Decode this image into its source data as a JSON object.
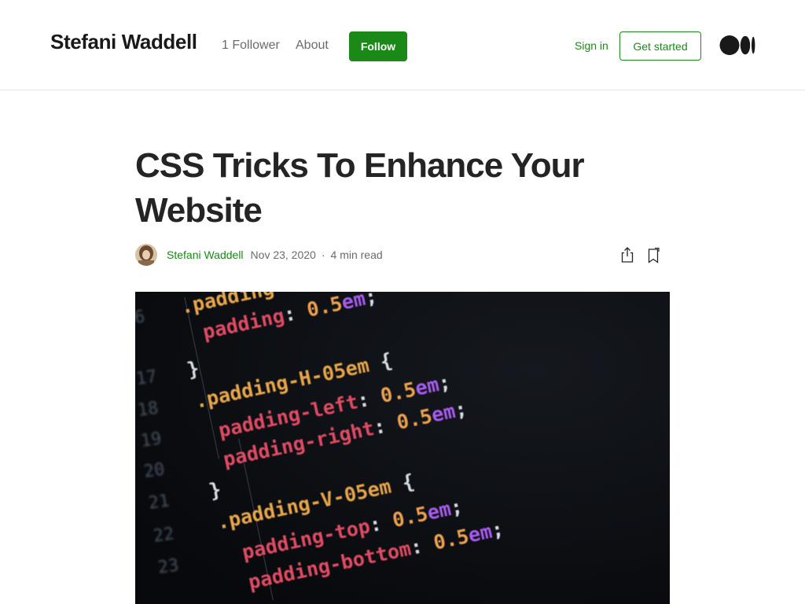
{
  "header": {
    "publication_name": "Stefani Waddell",
    "followers": "1 Follower",
    "about": "About",
    "follow": "Follow",
    "sign_in": "Sign in",
    "get_started": "Get started",
    "logo_icon": "medium-logo-icon"
  },
  "article": {
    "title": "CSS Tricks To Enhance Your Website",
    "author": "Stefani Waddell",
    "date": "Nov 23, 2020",
    "separator": "·",
    "read_time": "4 min read",
    "share_icon": "share-icon",
    "bookmark_icon": "bookmark-icon"
  },
  "hero_image": {
    "line_numbers": [
      "6",
      "17",
      "18",
      "19",
      "20",
      "21",
      "22",
      "23"
    ],
    "code_lines": [
      {
        "selector": ".padding",
        "rest": ""
      },
      {
        "prop": "padding",
        "value": "0.5",
        "unit": "em",
        "end": ";"
      },
      {
        "brace": "}"
      },
      {
        "selector": ".padding-H-05em",
        "brace": "{"
      },
      {
        "prop": "padding-left",
        "value": "0.5",
        "unit": "em",
        "end": ";"
      },
      {
        "prop": "padding-right",
        "value": "0.5",
        "unit": "em",
        "end": ";"
      },
      {
        "brace": "}"
      },
      {
        "selector": ".padding-V-05em",
        "brace": "{"
      },
      {
        "prop": "padding-top",
        "value": "0.5",
        "unit": "em",
        "end": ";"
      },
      {
        "prop": "padding-bottom",
        "value": "0.5",
        "unit": "em",
        "end": ";"
      }
    ]
  },
  "colors": {
    "brand_green": "#1a8917",
    "text_dark": "#242424",
    "text_muted": "#6b6b6b",
    "code_selector": "#e8a64a",
    "code_property": "#e04b63",
    "code_value": "#f0a24e",
    "code_unit": "#a85df0"
  }
}
